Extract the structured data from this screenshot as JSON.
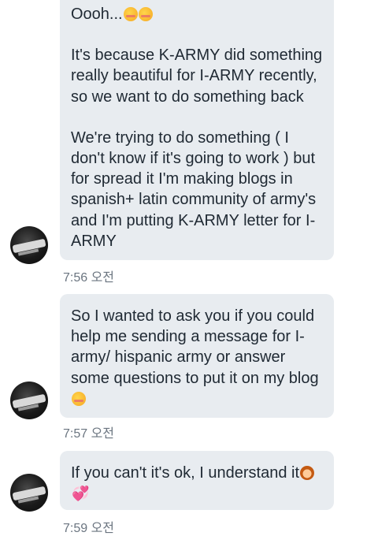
{
  "messages": [
    {
      "paragraphs": [
        "Oooh...",
        "It's because K-ARMY did something really beautiful for I-ARMY recently, so we want to do something back",
        "We're trying to do something ( I don't know if it's going to work ) but for spread it I'm making blogs in spanish+ latin community of army's and I'm putting K-ARMY letter for I-ARMY"
      ],
      "time": "7:56 오전"
    },
    {
      "paragraphs": [
        "So I wanted to ask you if you could help me sending a message for I-army/ hispanic army or answer some questions to put it on my blog"
      ],
      "time": "7:57 오전"
    },
    {
      "paragraphs": [
        "If you can't it's ok, I understand it"
      ],
      "time": "7:59 오전"
    }
  ],
  "emoji_icons": [
    "blushing-face-icon",
    "kissing-face-icon",
    "person-icon",
    "heart-icon"
  ],
  "colors": {
    "bubble_bg": "#e8ecf0",
    "text": "#1f2933",
    "timestamp": "#6b7580",
    "background": "#ffffff"
  }
}
